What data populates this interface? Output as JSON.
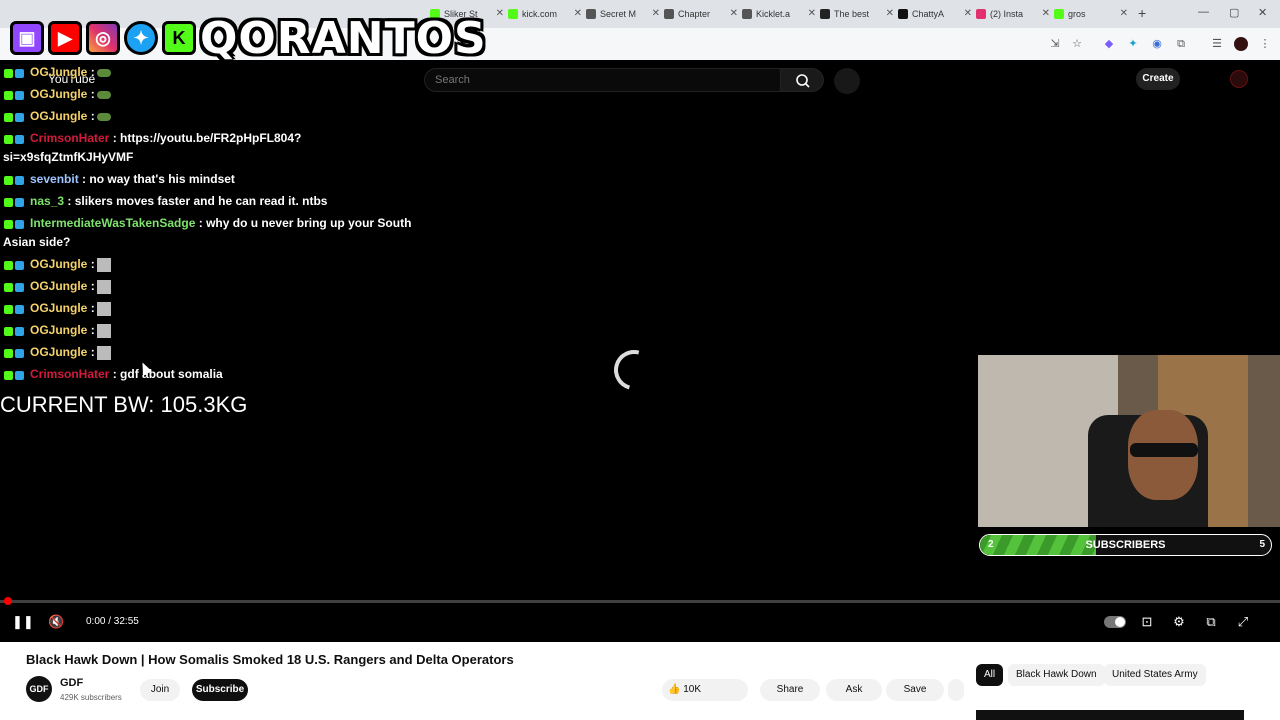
{
  "overlay": {
    "brand_text": "QORANTOS"
  },
  "browser": {
    "tabs": [
      {
        "label": "Sliker St",
        "color": "#53fc18"
      },
      {
        "label": "kick.com",
        "color": "#53fc18"
      },
      {
        "label": "Secret M",
        "color": "#555555"
      },
      {
        "label": "Chapter",
        "color": "#555555"
      },
      {
        "label": "Kicklet.a",
        "color": "#555555"
      },
      {
        "label": "The best",
        "color": "#222222"
      },
      {
        "label": "ChattyA",
        "color": "#111111"
      },
      {
        "label": "(2) Insta",
        "color": "#e1306c"
      },
      {
        "label": "gros",
        "color": "#53fc18"
      }
    ]
  },
  "youtube": {
    "logo_text": "YouTube",
    "search_placeholder": "Search",
    "create_label": "Create"
  },
  "chat": [
    {
      "user": "OGJungle",
      "text": ":",
      "user_color": "#f5d36b",
      "emote": "frog"
    },
    {
      "user": "OGJungle",
      "text": ":",
      "user_color": "#f5d36b",
      "emote": "frog"
    },
    {
      "user": "OGJungle",
      "text": ":",
      "user_color": "#f5d36b",
      "emote": "frog"
    },
    {
      "user": "CrimsonHater",
      "text": ": https://youtu.be/FR2pHpFL804?",
      "user_color": "#d21b3c"
    },
    {
      "user": "",
      "text": "si=x9sfqZtmfKJHyVMF",
      "user_color": "#ffffff"
    },
    {
      "user": "sevenbit",
      "text": ": no way that's his mindset",
      "user_color": "#9ec5ff"
    },
    {
      "user": "nas_3",
      "text": ": slikers moves faster and he can read it. ntbs",
      "user_color": "#7ee36b"
    },
    {
      "user": "IntermediateWasTakenSadge",
      "text": ": why do u never bring up your South",
      "user_color": "#7ee36b"
    },
    {
      "user": "",
      "text": "Asian side?",
      "user_color": "#ffffff"
    },
    {
      "user": "OGJungle",
      "text": ":",
      "user_color": "#f5d36b",
      "emote": "pic"
    },
    {
      "user": "OGJungle",
      "text": ":",
      "user_color": "#f5d36b",
      "emote": "pic"
    },
    {
      "user": "OGJungle",
      "text": ":",
      "user_color": "#f5d36b",
      "emote": "pic"
    },
    {
      "user": "OGJungle",
      "text": ":",
      "user_color": "#f5d36b",
      "emote": "pic"
    },
    {
      "user": "OGJungle",
      "text": ":",
      "user_color": "#f5d36b",
      "emote": "pic"
    },
    {
      "user": "CrimsonHater",
      "text": ": gdf about somalia",
      "user_color": "#d21b3c"
    }
  ],
  "stream": {
    "bodyweight_text": "CURRENT BW: 105.3KG"
  },
  "sub_goal": {
    "current": "2",
    "label": "SUBSCRIBERS",
    "goal": "5",
    "progress": 0.4
  },
  "player": {
    "time": "0:00 / 32:55"
  },
  "video": {
    "title": "Black Hawk Down | How Somalis Smoked 18 U.S. Rangers and Delta Operators",
    "channel_avatar": "GDF",
    "channel_name": "GDF",
    "channel_subs": "429K subscribers",
    "join_label": "Join",
    "subscribe_label": "Subscribe",
    "likes": "10K",
    "share_label": "Share",
    "ask_label": "Ask",
    "save_label": "Save"
  },
  "chips": [
    "All",
    "Black Hawk Down",
    "United States Army"
  ]
}
